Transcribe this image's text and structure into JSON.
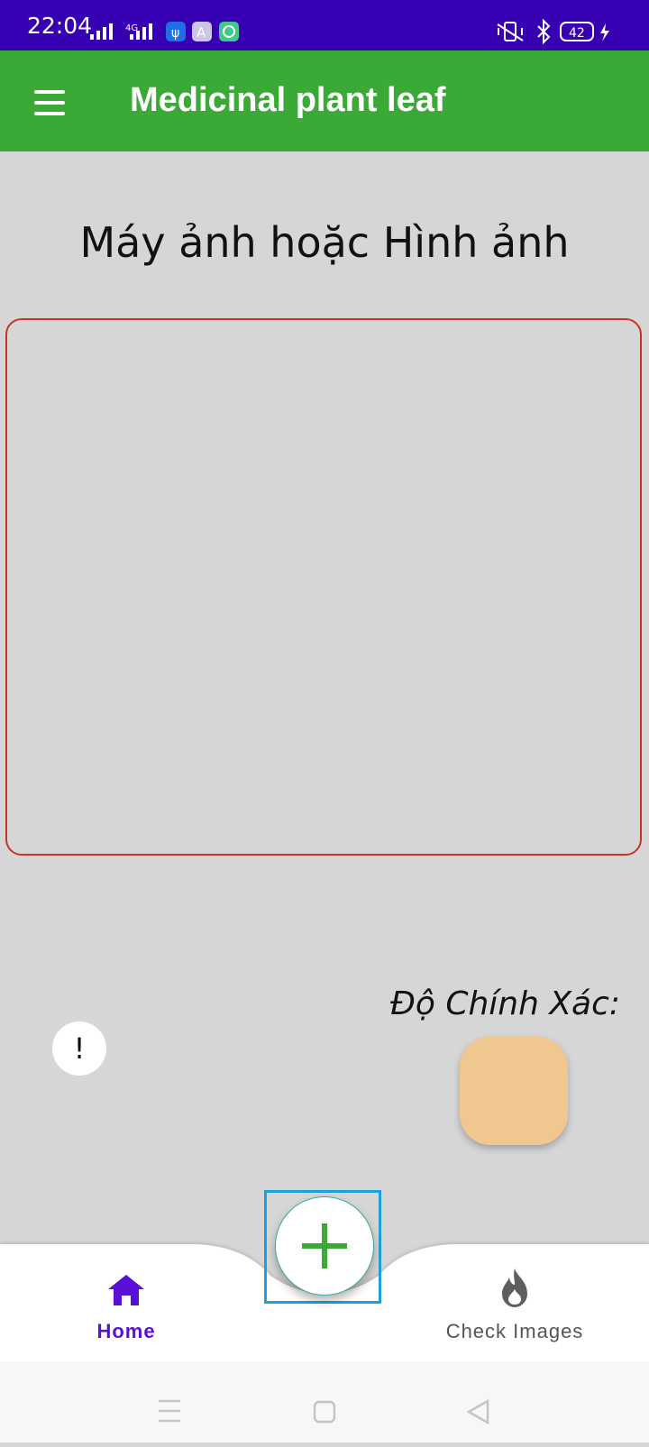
{
  "status_bar": {
    "time": "22:04",
    "battery": "42",
    "network_type": "4G"
  },
  "app_bar": {
    "title": "Medicinal plant leaf",
    "menu_icon": "hamburger-menu-icon"
  },
  "main": {
    "heading": "Máy ảnh hoặc Hình ảnh",
    "accuracy_label": "Độ Chính Xác:",
    "info_button_label": "!",
    "colors": {
      "app_bar": "#3aa935",
      "status_bar": "#3700b3",
      "image_frame_border": "#c43526",
      "accuracy_box": "#efc78f",
      "fab_plus": "#3aa935",
      "nav_active": "#5a0fd6"
    }
  },
  "bottom_nav": {
    "items": [
      {
        "label": "Home",
        "icon": "home-icon",
        "active": true
      },
      {
        "label": "Check Images",
        "icon": "flame-icon",
        "active": false
      }
    ],
    "fab_icon": "plus-icon"
  },
  "system_nav": {
    "icons": [
      "recents-icon",
      "home-square-icon",
      "back-triangle-icon"
    ]
  }
}
